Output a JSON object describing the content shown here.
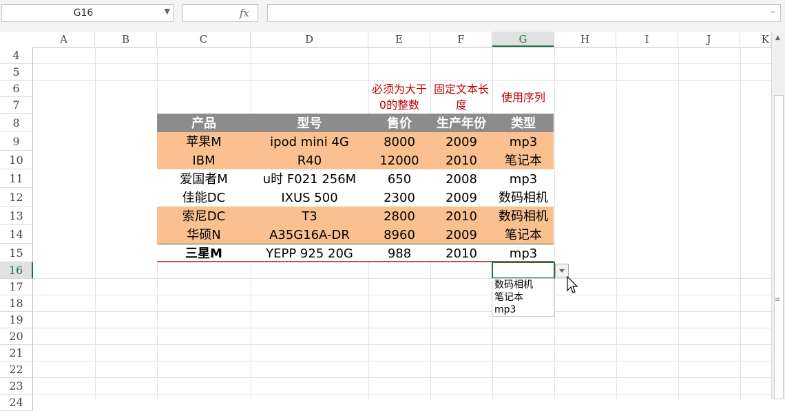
{
  "formula_bar": {
    "name_box": "G16",
    "fx_label": "fx",
    "formula_value": ""
  },
  "columns": [
    "A",
    "B",
    "C",
    "D",
    "E",
    "F",
    "G",
    "H",
    "I",
    "J",
    "K"
  ],
  "rows": [
    "4",
    "5",
    "6",
    "7",
    "8",
    "9",
    "10",
    "11",
    "12",
    "13",
    "14",
    "15",
    "16",
    "17",
    "18",
    "19",
    "20",
    "21",
    "22",
    "23",
    "24"
  ],
  "notes": {
    "price": "必须为大于0的整数",
    "year": "固定文本长度",
    "type": "使用序列"
  },
  "table": {
    "headers": [
      "产品",
      "型号",
      "售价",
      "生产年份",
      "类型"
    ],
    "rows": [
      [
        "苹果M",
        "ipod mini 4G",
        "8000",
        "2009",
        "mp3"
      ],
      [
        "IBM",
        "R40",
        "12000",
        "2010",
        "笔记本"
      ],
      [
        "爱国者M",
        "u时 F021 256M",
        "650",
        "2008",
        "mp3"
      ],
      [
        "佳能DC",
        "IXUS 500",
        "2300",
        "2009",
        "数码相机"
      ],
      [
        "索尼DC",
        "T3",
        "2800",
        "2010",
        "数码相机"
      ],
      [
        "华硕N",
        "A35G16A-DR",
        "8960",
        "2009",
        "笔记本"
      ],
      [
        "三星M",
        "YEPP 925 20G",
        "988",
        "2010",
        "mp3"
      ]
    ]
  },
  "dropdown": {
    "options": [
      "数码相机",
      "笔记本",
      "mp3"
    ]
  },
  "colors": {
    "header_bg": "#8c8c8c",
    "band_orange": "#fac090",
    "note_red": "#c00000",
    "selection_green": "#217346"
  }
}
